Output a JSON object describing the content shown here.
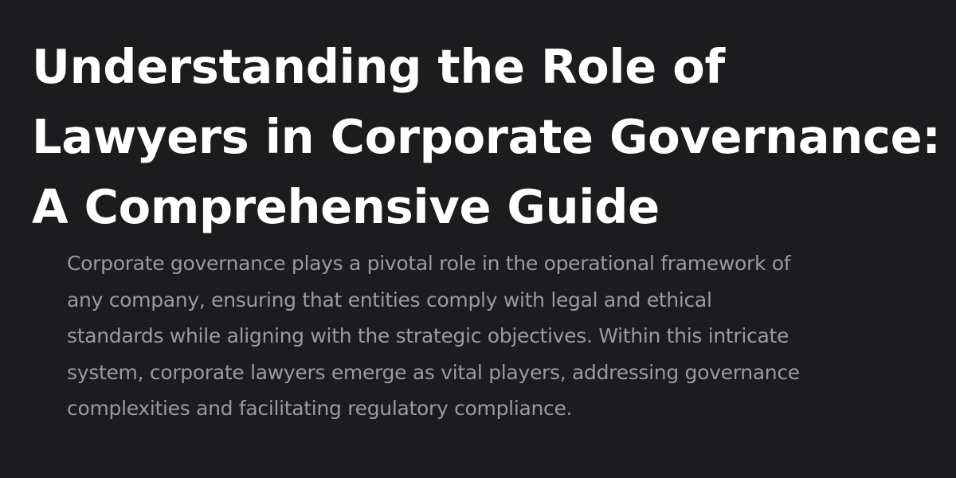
{
  "article": {
    "title_lines": [
      "Understanding the Role of",
      "Lawyers in Corporate Governance:",
      "A Comprehensive Guide"
    ],
    "excerpt_lines": [
      "Corporate governance plays a pivotal role in the operational framework of",
      "any company, ensuring that entities comply with legal and ethical",
      "standards while aligning with the strategic objectives. Within this intricate",
      "system, corporate lawyers emerge as vital players, addressing governance",
      "complexities and facilitating regulatory compliance."
    ]
  },
  "colors": {
    "background": "#1c1c1e",
    "title": "#ffffff",
    "excerpt": "#9a9aa0"
  }
}
